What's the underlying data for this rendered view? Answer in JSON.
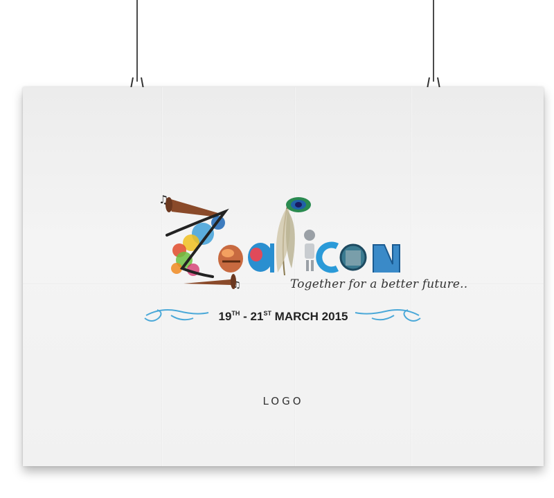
{
  "poster": {
    "tagline": "Together for a better future..",
    "date": {
      "start_day": "19",
      "start_suffix": "TH",
      "separator": " - 21",
      "end_suffix": "ST",
      "month_year": " MARCH 2015"
    },
    "placeholder_label": "LOGO"
  },
  "colors": {
    "swirl": "#4aa8d8",
    "trumpet": "#8a4a2a",
    "text": "#222222"
  },
  "icons": [
    "binder-clip-icon",
    "music-note-icon",
    "trumpet-icon",
    "peacock-feather-icon",
    "robot-icon"
  ]
}
